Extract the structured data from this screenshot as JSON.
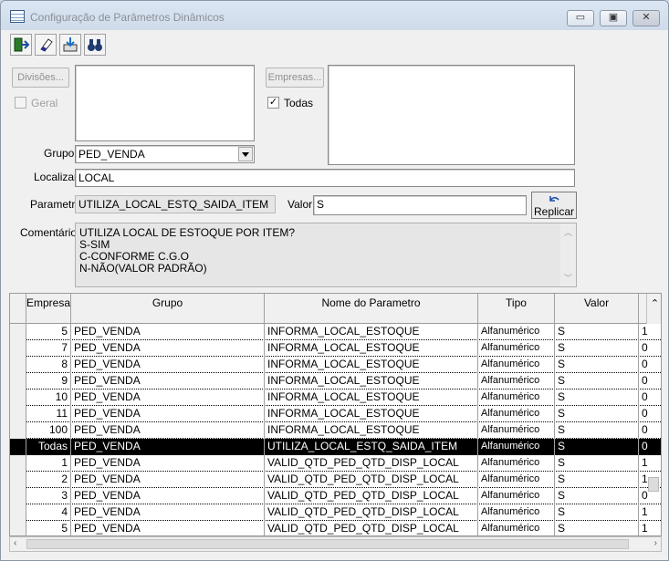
{
  "window": {
    "title": "Configuração de Parâmetros Dinâmicos",
    "controls": {
      "minimize": "▭",
      "maximize": "▣",
      "close": "✕"
    }
  },
  "toolbar": {
    "icons": [
      "exit-icon",
      "eraser-icon",
      "save-icon",
      "search-binoculars-icon"
    ]
  },
  "filters": {
    "divisoes_label": "Divisões...",
    "geral_label": "Geral",
    "geral_checked": false,
    "empresas_label": "Empresas...",
    "todas_label": "Todas",
    "todas_checked": true,
    "todas_mark": "✓",
    "grupo_label": "Grupo",
    "grupo_value": "PED_VENDA",
    "localizar_label": "Localizar",
    "localizar_value": "LOCAL"
  },
  "parametro": {
    "label": "Parametro",
    "value": "UTILIZA_LOCAL_ESTQ_SAIDA_ITEM",
    "valor_label": "Valor",
    "valor_value": "S",
    "replicar_label": "Replicar",
    "comentarios_label": "Comentários",
    "comentarios_lines": [
      "UTILIZA LOCAL DE ESTOQUE POR ITEM?",
      "S-SIM",
      "C-CONFORME C.G.O",
      "N-NÃO(VALOR PADRÃO)"
    ]
  },
  "grid": {
    "columns": [
      "Empresa",
      "Grupo",
      "Nome do Parametro",
      "Tipo",
      "Valor"
    ],
    "rows": [
      {
        "empresa": "5",
        "grupo": "PED_VENDA",
        "nome": "INFORMA_LOCAL_ESTOQUE",
        "tipo": "Alfanumérico",
        "valor": "S",
        "extra": "1",
        "selected": false
      },
      {
        "empresa": "7",
        "grupo": "PED_VENDA",
        "nome": "INFORMA_LOCAL_ESTOQUE",
        "tipo": "Alfanumérico",
        "valor": "S",
        "extra": "0",
        "selected": false
      },
      {
        "empresa": "8",
        "grupo": "PED_VENDA",
        "nome": "INFORMA_LOCAL_ESTOQUE",
        "tipo": "Alfanumérico",
        "valor": "S",
        "extra": "0",
        "selected": false
      },
      {
        "empresa": "9",
        "grupo": "PED_VENDA",
        "nome": "INFORMA_LOCAL_ESTOQUE",
        "tipo": "Alfanumérico",
        "valor": "S",
        "extra": "0",
        "selected": false
      },
      {
        "empresa": "10",
        "grupo": "PED_VENDA",
        "nome": "INFORMA_LOCAL_ESTOQUE",
        "tipo": "Alfanumérico",
        "valor": "S",
        "extra": "0",
        "selected": false
      },
      {
        "empresa": "11",
        "grupo": "PED_VENDA",
        "nome": "INFORMA_LOCAL_ESTOQUE",
        "tipo": "Alfanumérico",
        "valor": "S",
        "extra": "0",
        "selected": false
      },
      {
        "empresa": "100",
        "grupo": "PED_VENDA",
        "nome": "INFORMA_LOCAL_ESTOQUE",
        "tipo": "Alfanumérico",
        "valor": "S",
        "extra": "0",
        "selected": false
      },
      {
        "empresa": "Todas",
        "grupo": "PED_VENDA",
        "nome": "UTILIZA_LOCAL_ESTQ_SAIDA_ITEM",
        "tipo": "Alfanumérico",
        "valor": "S",
        "extra": "0",
        "selected": true
      },
      {
        "empresa": "1",
        "grupo": "PED_VENDA",
        "nome": "VALID_QTD_PED_QTD_DISP_LOCAL",
        "tipo": "Alfanumérico",
        "valor": "S",
        "extra": "1",
        "selected": false
      },
      {
        "empresa": "2",
        "grupo": "PED_VENDA",
        "nome": "VALID_QTD_PED_QTD_DISP_LOCAL",
        "tipo": "Alfanumérico",
        "valor": "S",
        "extra": "1",
        "selected": false
      },
      {
        "empresa": "3",
        "grupo": "PED_VENDA",
        "nome": "VALID_QTD_PED_QTD_DISP_LOCAL",
        "tipo": "Alfanumérico",
        "valor": "S",
        "extra": "0",
        "selected": false
      },
      {
        "empresa": "4",
        "grupo": "PED_VENDA",
        "nome": "VALID_QTD_PED_QTD_DISP_LOCAL",
        "tipo": "Alfanumérico",
        "valor": "S",
        "extra": "1",
        "selected": false
      },
      {
        "empresa": "5",
        "grupo": "PED_VENDA",
        "nome": "VALID_QTD_PED_QTD_DISP_LOCAL",
        "tipo": "Alfanumérico",
        "valor": "S",
        "extra": "1",
        "selected": false
      }
    ]
  }
}
